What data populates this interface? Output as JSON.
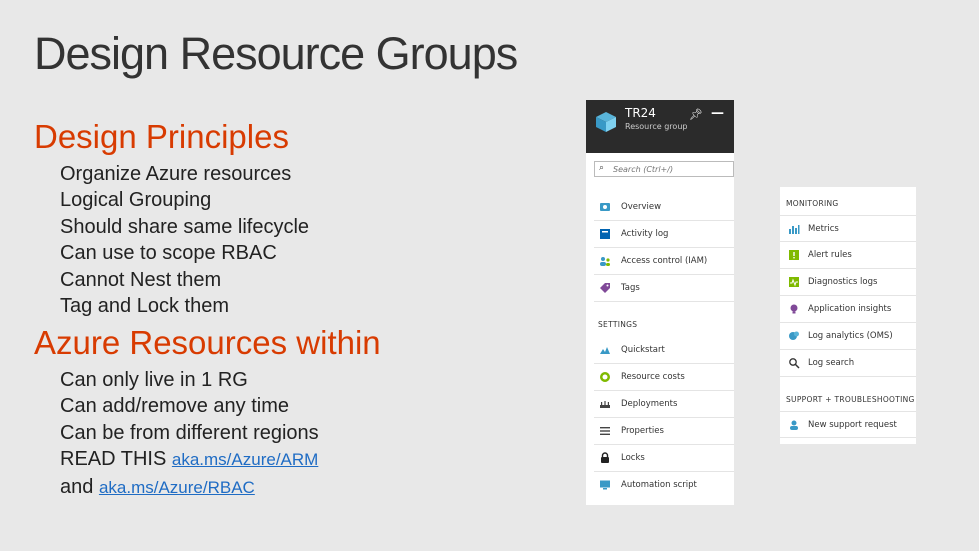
{
  "slide": {
    "title": "Design Resource Groups",
    "section1": {
      "heading": "Design Principles",
      "bullets": [
        "Organize Azure resources",
        "Logical Grouping",
        "Should share same lifecycle",
        "Can use to scope RBAC",
        "Cannot Nest them",
        "Tag and Lock them"
      ]
    },
    "section2": {
      "heading": "Azure Resources within",
      "bullets": [
        "Can only live in 1 RG",
        "Can add/remove any time",
        "Can be from different regions"
      ],
      "read_prefix": "READ THIS",
      "read_link": "aka.ms/Azure/ARM",
      "and_prefix": "and",
      "and_link": "aka.ms/Azure/RBAC"
    }
  },
  "resource_group_blade": {
    "title": "TR24",
    "subtitle": "Resource group",
    "icons": {
      "resource_group": "cube-icon",
      "pin": "pin-icon",
      "minimize": "minimize-icon"
    },
    "search": {
      "placeholder": "Search (Ctrl+/)"
    },
    "items": [
      {
        "label": "Overview",
        "icon": "overview-icon"
      },
      {
        "label": "Activity log",
        "icon": "activity-log-icon"
      },
      {
        "label": "Access control (IAM)",
        "icon": "users-icon"
      },
      {
        "label": "Tags",
        "icon": "tag-icon"
      }
    ],
    "settings_label": "SETTINGS",
    "settings_items": [
      {
        "label": "Quickstart",
        "icon": "quickstart-icon"
      },
      {
        "label": "Resource costs",
        "icon": "costs-icon"
      },
      {
        "label": "Deployments",
        "icon": "deployments-icon"
      },
      {
        "label": "Properties",
        "icon": "properties-icon"
      },
      {
        "label": "Locks",
        "icon": "lock-icon"
      },
      {
        "label": "Automation script",
        "icon": "automation-icon"
      }
    ]
  },
  "monitoring_blade": {
    "monitoring_label": "MONITORING",
    "monitoring_items": [
      {
        "label": "Metrics",
        "icon": "metrics-icon"
      },
      {
        "label": "Alert rules",
        "icon": "alert-icon"
      },
      {
        "label": "Diagnostics logs",
        "icon": "diagnostics-icon"
      },
      {
        "label": "Application insights",
        "icon": "lightbulb-icon"
      },
      {
        "label": "Log analytics (OMS)",
        "icon": "log-analytics-icon"
      },
      {
        "label": "Log search",
        "icon": "search-icon"
      }
    ],
    "support_label": "SUPPORT + TROUBLESHOOTING",
    "support_items": [
      {
        "label": "New support request",
        "icon": "support-icon"
      }
    ]
  },
  "colors": {
    "accent": "#d83b01",
    "link": "#1f6cc4",
    "background": "#e8e8e8",
    "blade_header": "#2b2b2b"
  }
}
